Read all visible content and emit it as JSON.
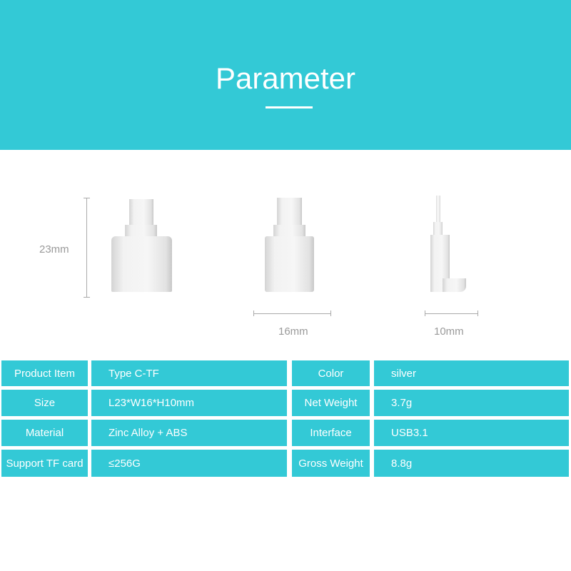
{
  "header": {
    "title": "Parameter"
  },
  "dimensions": {
    "length": "23mm",
    "width": "16mm",
    "height": "10mm"
  },
  "specs": [
    {
      "label": "Product Item",
      "value": "Type C-TF",
      "label2": "Color",
      "value2": "silver"
    },
    {
      "label": "Size",
      "value": "L23*W16*H10mm",
      "label2": "Net Weight",
      "value2": "3.7g"
    },
    {
      "label": "Material",
      "value": "Zinc Alloy + ABS",
      "label2": "Interface",
      "value2": "USB3.1"
    },
    {
      "label": "Support TF card",
      "value": "≤256G",
      "label2": "Gross Weight",
      "value2": "8.8g"
    }
  ],
  "colors": {
    "accent": "#33c9d6"
  }
}
